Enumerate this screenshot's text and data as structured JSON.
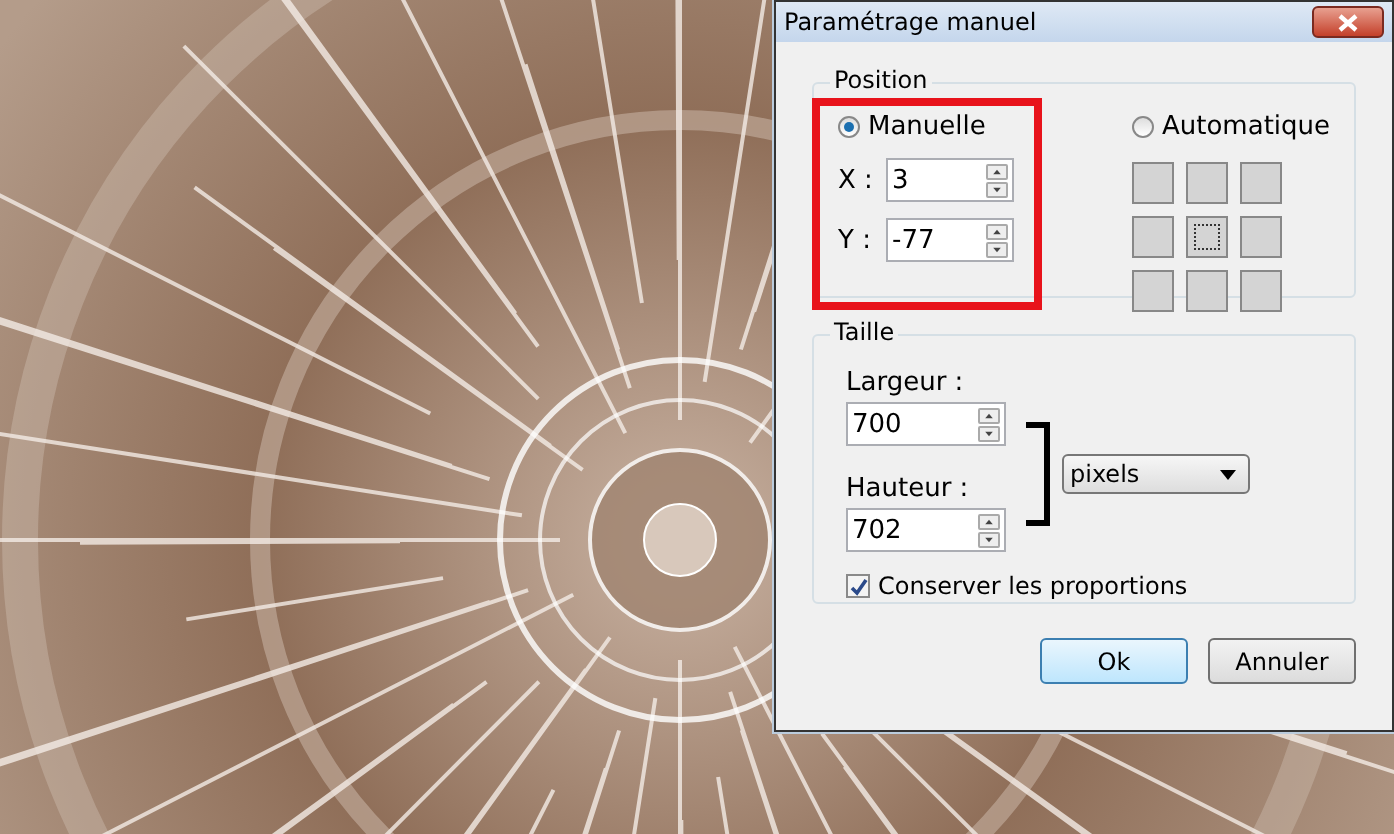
{
  "window": {
    "title": "Paramétrage manuel"
  },
  "position": {
    "title": "Position",
    "modes": [
      {
        "label": "Manuelle",
        "selected": true
      },
      {
        "label": "Automatique",
        "selected": false
      }
    ],
    "fields": [
      {
        "label": "X :",
        "value": "3"
      },
      {
        "label": "Y :",
        "value": "-77"
      }
    ],
    "anchors": [
      {
        "selected": false
      },
      {
        "selected": false
      },
      {
        "selected": false
      },
      {
        "selected": false
      },
      {
        "selected": true
      },
      {
        "selected": false
      },
      {
        "selected": false
      },
      {
        "selected": false
      },
      {
        "selected": false
      }
    ]
  },
  "size": {
    "title": "Taille",
    "fields": [
      {
        "label": "Largeur :",
        "value": "700"
      },
      {
        "label": "Hauteur :",
        "value": "702"
      }
    ],
    "unit": "pixels",
    "keep_ratio": {
      "label": "Conserver les proportions",
      "checked": true
    }
  },
  "buttons": [
    {
      "label": "Ok",
      "default": true
    },
    {
      "label": "Annuler",
      "default": false
    }
  ]
}
